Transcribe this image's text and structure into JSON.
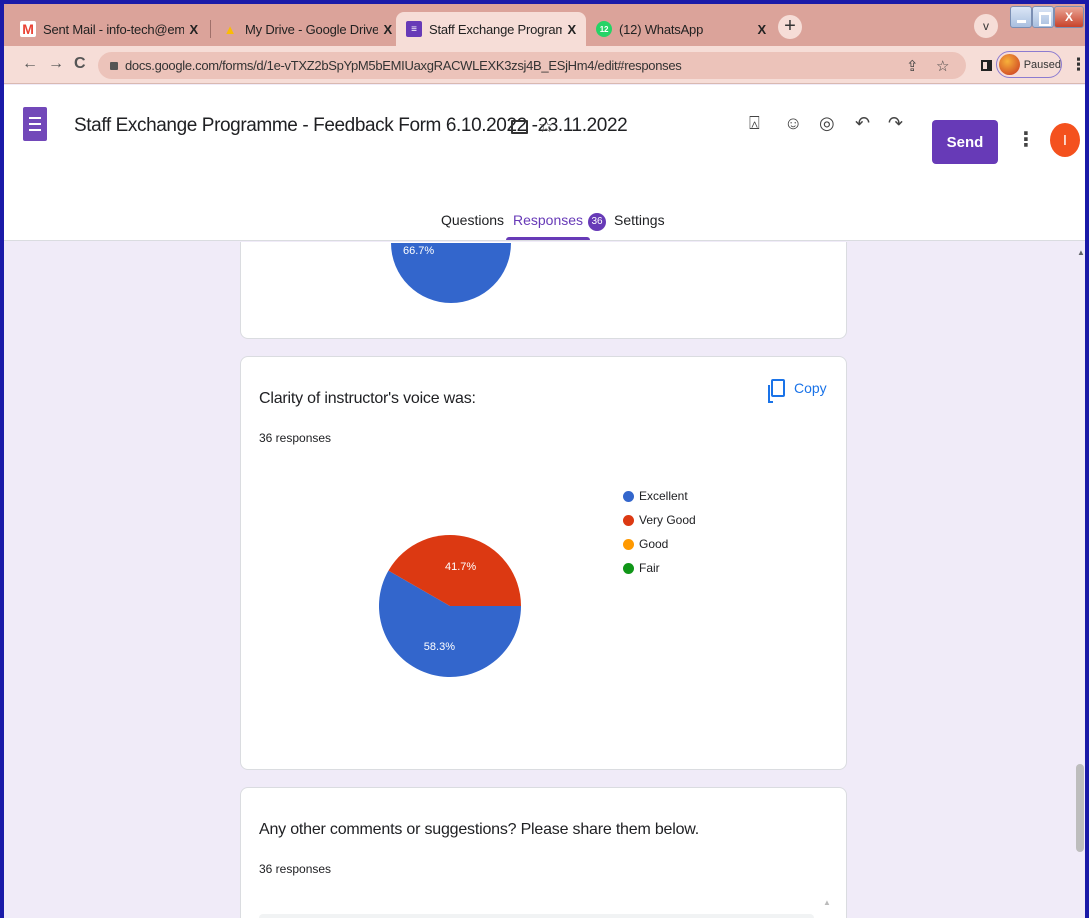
{
  "browser": {
    "tabs": [
      {
        "title": "Sent Mail - info-tech@emgywom",
        "favicon": "gmail-icon",
        "color": "#ea4335",
        "glyph": "M"
      },
      {
        "title": "My Drive - Google Drive",
        "favicon": "google-drive-icon",
        "color": "#fbbc04",
        "glyph": "▲"
      },
      {
        "title": "Staff Exchange Programme - Fee",
        "favicon": "google-forms-icon",
        "color": "#673ab7",
        "glyph": "≡"
      },
      {
        "title": "(12) WhatsApp",
        "favicon": "whatsapp-icon",
        "color": "#25d366",
        "glyph": "12"
      }
    ],
    "tab_close": "X",
    "new_tab": "+",
    "tab_menu": "v",
    "window_close": "X",
    "back": "←",
    "forward": "→",
    "reload": "C",
    "url": "docs.google.com/forms/d/1e-vTXZ2bSpYpM5bEMIUaxgRACWLEXK3zsj4B_ESjHm4/edit#responses",
    "share_icon": "⇪",
    "bookmark_icon": "☆",
    "profile_label": "Paused",
    "menu_icon": "⋮"
  },
  "header": {
    "title": "Staff Exchange Programme - Feedback Form 6.10.2022 -23.11.2022",
    "star": "☆",
    "icons": {
      "addon": "⍓",
      "palette": "☺",
      "preview": "◎",
      "undo": "↶",
      "redo": "↷"
    },
    "send_label": "Send",
    "more": "⋮",
    "avatar_letter": "I"
  },
  "form_tabs": {
    "questions": "Questions",
    "responses": "Responses",
    "responses_count": "36",
    "settings": "Settings"
  },
  "cards": {
    "prev_pie_label": "66.7%",
    "clarity": {
      "title": "Clarity of instructor's voice was:",
      "responses": "36 responses",
      "copy_label": "Copy"
    },
    "comments": {
      "title": "Any other comments or suggestions?  Please share them below.",
      "responses": "36 responses"
    }
  },
  "colors": {
    "excellent": "#3366cc",
    "very_good": "#dc3912",
    "good": "#ff9900",
    "fair": "#109618",
    "accent": "#673ab7"
  },
  "chart_data": [
    {
      "type": "pie",
      "title": "Clarity of instructor's voice was:",
      "categories": [
        "Excellent",
        "Very Good",
        "Good",
        "Fair"
      ],
      "values": [
        58.3,
        41.7,
        0,
        0
      ],
      "labels": [
        "58.3%",
        "41.7%",
        "",
        ""
      ],
      "colors": [
        "#3366cc",
        "#dc3912",
        "#ff9900",
        "#109618"
      ],
      "legend": "right"
    }
  ]
}
